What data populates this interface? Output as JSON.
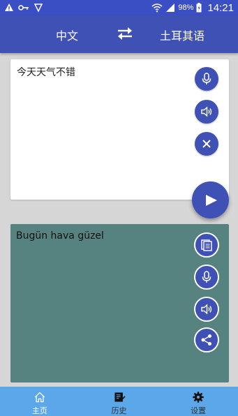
{
  "status_bar": {
    "battery_percent": "98%",
    "time": "14:21"
  },
  "language_bar": {
    "source_language": "中文",
    "target_language": "土耳其语"
  },
  "source": {
    "text": "今天天气不错"
  },
  "result": {
    "text": "Bugün hava güzel"
  },
  "bottom_nav": {
    "items": [
      {
        "label": "主页",
        "icon": "home-icon",
        "active": true
      },
      {
        "label": "历史",
        "icon": "history-icon",
        "active": false
      },
      {
        "label": "设置",
        "icon": "settings-icon",
        "active": false
      }
    ]
  },
  "colors": {
    "primary": "#3f51b5",
    "result_background": "#56827f",
    "bottom_nav": "#5ba7e9",
    "page_background": "#d6d6d6"
  }
}
